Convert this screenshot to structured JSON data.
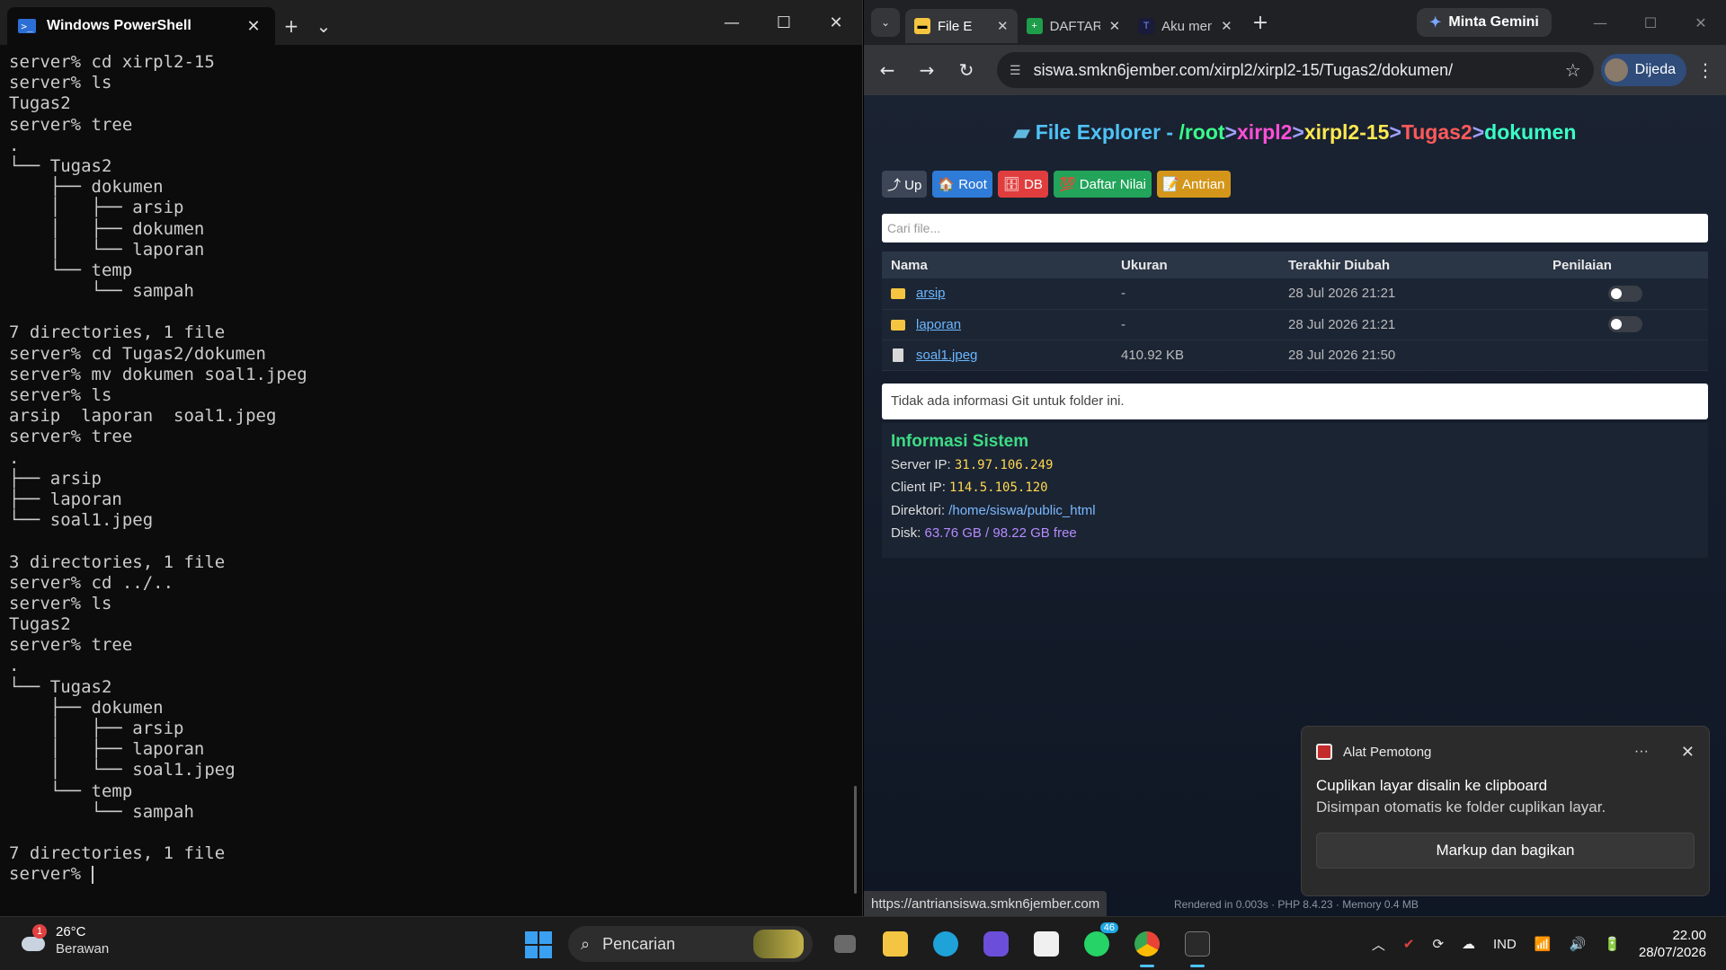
{
  "terminal": {
    "tab_title": "Windows PowerShell",
    "lines": [
      "server% cd xirpl2-15",
      "server% ls",
      "Tugas2",
      "server% tree",
      ".",
      "└── Tugas2",
      "    ├── dokumen",
      "    │   ├── arsip",
      "    │   ├── dokumen",
      "    │   └── laporan",
      "    └── temp",
      "        └── sampah",
      "",
      "7 directories, 1 file",
      "server% cd Tugas2/dokumen",
      "server% mv dokumen soal1.jpeg",
      "server% ls",
      "arsip  laporan  soal1.jpeg",
      "server% tree",
      ".",
      "├── arsip",
      "├── laporan",
      "└── soal1.jpeg",
      "",
      "3 directories, 1 file",
      "server% cd ../..",
      "server% ls",
      "Tugas2",
      "server% tree",
      ".",
      "└── Tugas2",
      "    ├── dokumen",
      "    │   ├── arsip",
      "    │   ├── laporan",
      "    │   └── soal1.jpeg",
      "    └── temp",
      "        └── sampah",
      "",
      "7 directories, 1 file"
    ],
    "prompt": "server% "
  },
  "browser": {
    "tabs": [
      {
        "label": "File E",
        "active": true
      },
      {
        "label": "DAFTAR",
        "active": false
      },
      {
        "label": "Aku men",
        "active": false
      }
    ],
    "gemini": "Minta Gemini",
    "url": "siswa.smkn6jember.com/xirpl2/xirpl2-15/Tugas2/dokumen/",
    "profile": "Dijeda",
    "status_url": "https://antriansiswa.smkn6jember.com",
    "rendered": "Rendered in 0.003s · PHP 8.4.23 · Memory 0.4 MB"
  },
  "page": {
    "title": "File Explorer - ",
    "path": [
      "/root",
      "xirpl2",
      "xirpl2-15",
      "Tugas2",
      "dokumen"
    ],
    "path_sep": ">",
    "buttons": {
      "up": "⤴ Up",
      "root": "🏠 Root",
      "db": "🗄 DB",
      "nilai": "💯 Daftar Nilai",
      "antrian": "📝 Antrian"
    },
    "search_placeholder": "Cari file...",
    "columns": [
      "Nama",
      "Ukuran",
      "Terakhir Diubah",
      "Penilaian"
    ],
    "rows": [
      {
        "name": "arsip",
        "type": "folder",
        "size": "-",
        "modified": "28 Jul 2026 21:21",
        "toggle": true
      },
      {
        "name": "laporan",
        "type": "folder",
        "size": "-",
        "modified": "28 Jul 2026 21:21",
        "toggle": true
      },
      {
        "name": "soal1.jpeg",
        "type": "file",
        "size": "410.92 KB",
        "modified": "28 Jul 2026 21:50",
        "toggle": false
      }
    ],
    "git_info": "Tidak ada informasi Git untuk folder ini.",
    "sysinfo": {
      "heading": "Informasi Sistem",
      "server_ip_label": "Server IP: ",
      "server_ip": "31.97.106.249",
      "client_ip_label": "Client IP: ",
      "client_ip": "114.5.105.120",
      "dir_label": "Direktori: ",
      "dir": "/home/siswa/public_html",
      "disk_label": "Disk: ",
      "disk": "63.76 GB / 98.22 GB free"
    }
  },
  "toast": {
    "app": "Alat Pemotong",
    "title": "Cuplikan layar disalin ke clipboard",
    "message": "Disimpan otomatis ke folder cuplikan layar.",
    "button": "Markup dan bagikan"
  },
  "taskbar": {
    "weather_badge": "1",
    "temp": "26°C",
    "weather": "Berawan",
    "search": "Pencarian",
    "whatsapp_count": "46",
    "lang": "IND",
    "time": "22.00",
    "date": "28/07/2026"
  }
}
